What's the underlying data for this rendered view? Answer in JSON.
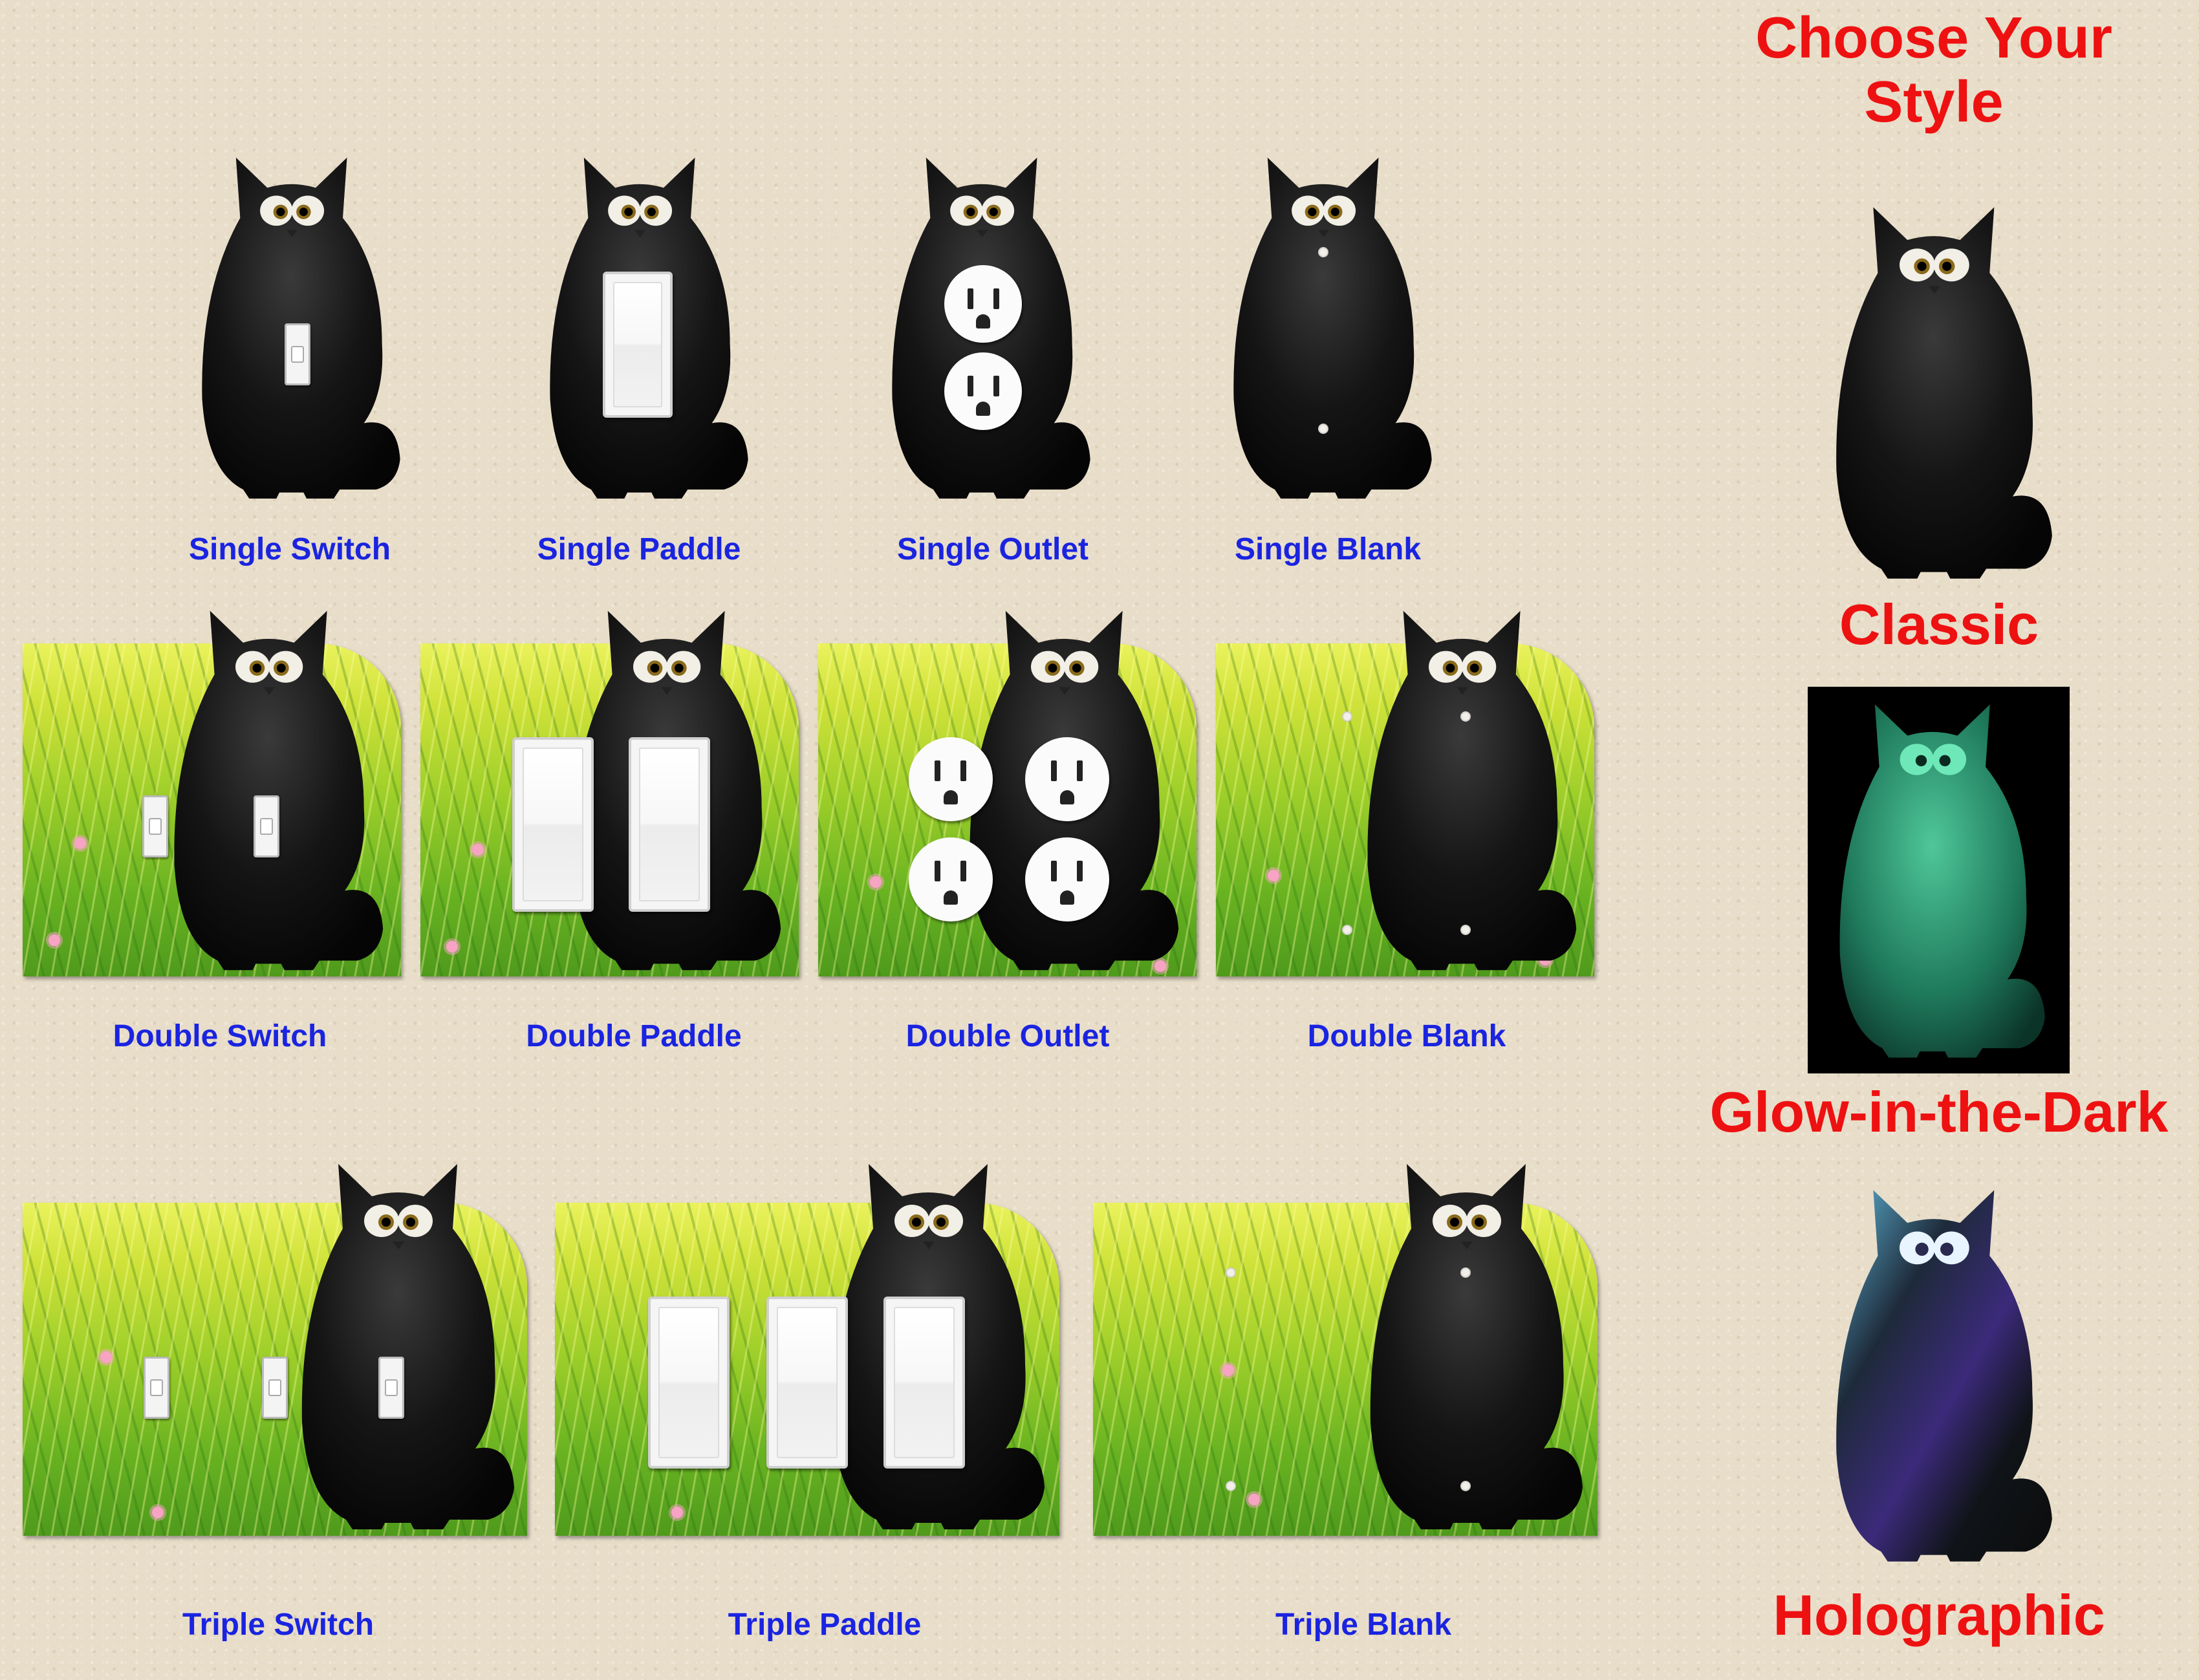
{
  "heading": {
    "line1": "Choose Your",
    "line2": "Style"
  },
  "styles": [
    {
      "label": "Classic"
    },
    {
      "label": "Glow-in-the-Dark"
    },
    {
      "label": "Holographic"
    }
  ],
  "row1": [
    "Single Switch",
    "Single Paddle",
    "Single Outlet",
    "Single Blank"
  ],
  "row2": [
    "Double Switch",
    "Double Paddle",
    "Double Outlet",
    "Double Blank"
  ],
  "row3": [
    "Triple Switch",
    "Triple Paddle",
    "Triple Blank"
  ],
  "colors": {
    "label_blue": "#1a24e0",
    "title_red": "#ee1111",
    "wall": "#e8ddc9",
    "cat_black": "#111111",
    "glow_green": "#2fa07a"
  },
  "icons": [
    "cat-icon",
    "light-switch-icon",
    "paddle-switch-icon",
    "outlet-icon",
    "screw-icon"
  ]
}
